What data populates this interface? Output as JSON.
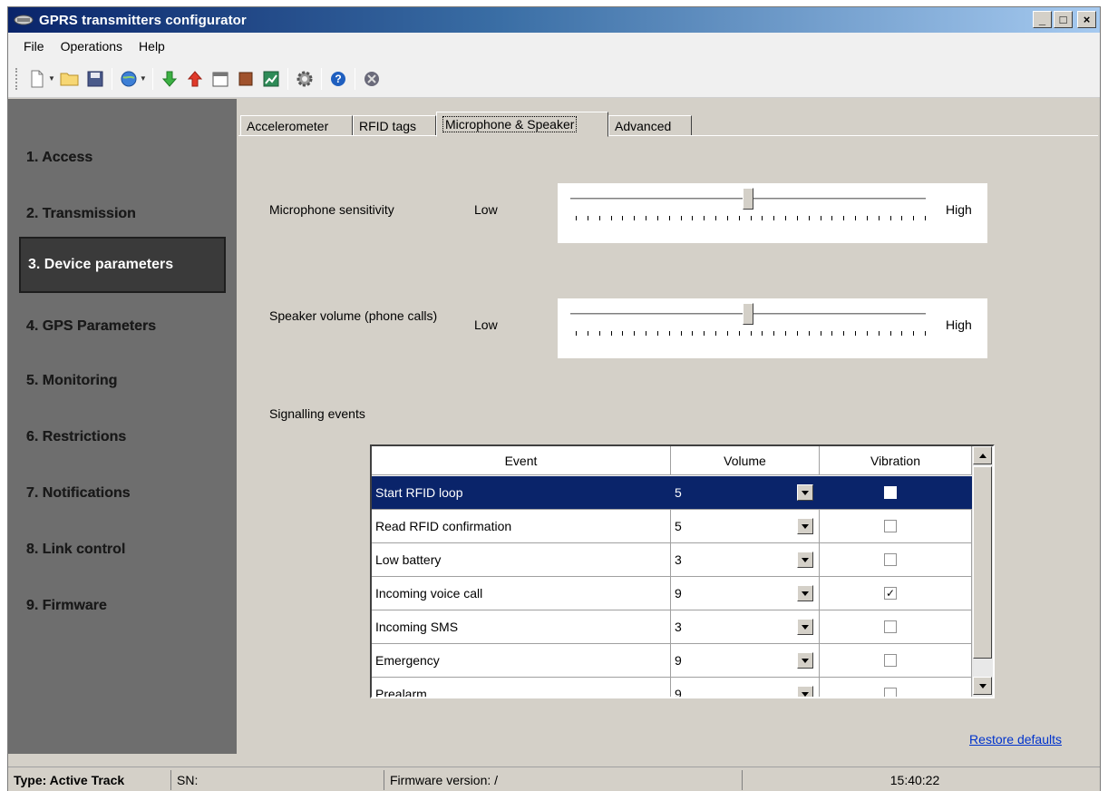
{
  "window": {
    "title": "GPRS transmitters configurator",
    "min": "_",
    "max": "□",
    "close": "×"
  },
  "menu": [
    "File",
    "Operations",
    "Help"
  ],
  "toolbar": {
    "icons": [
      "new-document-icon",
      "open-folder-icon",
      "save-icon",
      "globe-connect-icon",
      "download-arrow-icon",
      "upload-arrow-icon",
      "calendar-icon",
      "book-icon",
      "chart-icon",
      "settings-gear-icon",
      "help-icon",
      "disconnect-icon"
    ]
  },
  "sidebar": {
    "items": [
      {
        "label": "1. Access",
        "active": false
      },
      {
        "label": "2. Transmission",
        "active": false
      },
      {
        "label": "3. Device parameters",
        "active": true
      },
      {
        "label": "4. GPS Parameters",
        "active": false
      },
      {
        "label": "5. Monitoring",
        "active": false
      },
      {
        "label": "6. Restrictions",
        "active": false
      },
      {
        "label": "7. Notifications",
        "active": false
      },
      {
        "label": "8. Link control",
        "active": false
      },
      {
        "label": "9. Firmware",
        "active": false
      }
    ]
  },
  "tabs": [
    "Accelerometer",
    "RFID tags",
    "Microphone & Speaker",
    "Advanced"
  ],
  "active_tab": "Microphone & Speaker",
  "microphone": {
    "label": "Microphone sensitivity",
    "low": "Low",
    "high": "High",
    "level": 0.5
  },
  "speaker": {
    "label": "Speaker volume (phone calls)",
    "low": "Low",
    "high": "High",
    "level": 0.5
  },
  "signalling_label": "Signalling events",
  "table": {
    "headers": [
      "Event",
      "Volume",
      "Vibration"
    ],
    "rows": [
      {
        "event": "Start RFID loop",
        "volume": "5",
        "vibration": false,
        "selected": true
      },
      {
        "event": "Read RFID confirmation",
        "volume": "5",
        "vibration": false,
        "selected": false
      },
      {
        "event": "Low battery",
        "volume": "3",
        "vibration": false,
        "selected": false
      },
      {
        "event": "Incoming voice call",
        "volume": "9",
        "vibration": true,
        "selected": false
      },
      {
        "event": "Incoming SMS",
        "volume": "3",
        "vibration": false,
        "selected": false
      },
      {
        "event": "Emergency",
        "volume": "9",
        "vibration": false,
        "selected": false
      },
      {
        "event": "Prealarm",
        "volume": "9",
        "vibration": false,
        "selected": false
      }
    ]
  },
  "restore_defaults": "Restore defaults",
  "status": {
    "type": "Type: Active Track",
    "sn": "SN:",
    "firmware": "Firmware version: /",
    "time": "15:40:22"
  },
  "colors": {
    "selection": "#0a246a",
    "link": "#0033cc",
    "sidebar": "#6e6e6e"
  }
}
